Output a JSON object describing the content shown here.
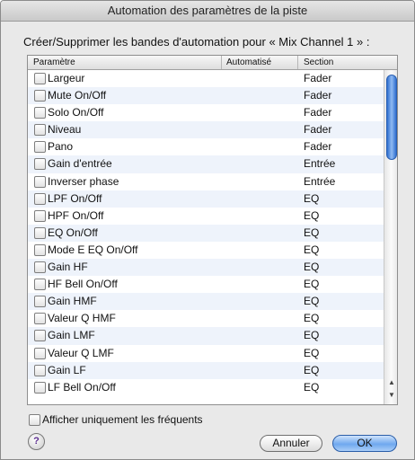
{
  "window": {
    "title": "Automation des paramètres de la piste"
  },
  "prompt": "Créer/Supprimer les bandes d'automation pour « Mix Channel 1 » :",
  "table": {
    "columns": [
      "Paramètre",
      "Automatisé",
      "Section"
    ],
    "rows": [
      {
        "param": "Largeur",
        "section": "Fader"
      },
      {
        "param": "Mute On/Off",
        "section": "Fader"
      },
      {
        "param": "Solo On/Off",
        "section": "Fader"
      },
      {
        "param": "Niveau",
        "section": "Fader"
      },
      {
        "param": "Pano",
        "section": "Fader"
      },
      {
        "param": "Gain d'entrée",
        "section": "Entrée"
      },
      {
        "param": "Inverser phase",
        "section": "Entrée"
      },
      {
        "param": "LPF On/Off",
        "section": "EQ"
      },
      {
        "param": "HPF On/Off",
        "section": "EQ"
      },
      {
        "param": "EQ On/Off",
        "section": "EQ"
      },
      {
        "param": "Mode E EQ On/Off",
        "section": "EQ"
      },
      {
        "param": "Gain HF",
        "section": "EQ"
      },
      {
        "param": "HF Bell On/Off",
        "section": "EQ"
      },
      {
        "param": "Gain HMF",
        "section": "EQ"
      },
      {
        "param": "Valeur Q HMF",
        "section": "EQ"
      },
      {
        "param": "Gain LMF",
        "section": "EQ"
      },
      {
        "param": "Valeur Q LMF",
        "section": "EQ"
      },
      {
        "param": "Gain LF",
        "section": "EQ"
      },
      {
        "param": "LF Bell On/Off",
        "section": "EQ"
      }
    ]
  },
  "options": {
    "frequent_only_label": "Afficher uniquement les fréquents"
  },
  "buttons": {
    "help": "?",
    "cancel": "Annuler",
    "ok": "OK"
  },
  "icons": {
    "scroll_up": "▲",
    "scroll_down": "▼"
  }
}
